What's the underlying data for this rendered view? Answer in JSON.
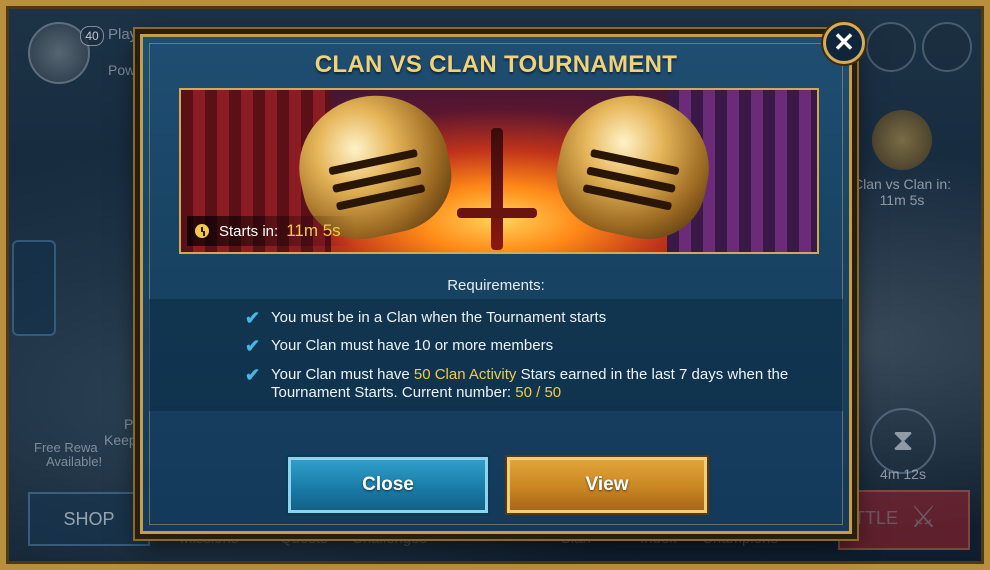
{
  "background": {
    "player_name": "Play",
    "player_level": "40",
    "power_label": "Power",
    "free_rewards": "Free Rewa",
    "available": "Available!",
    "side_text_1": "Pro",
    "side_text_2": "Keep p",
    "shop_label": "SHOP",
    "battle_label": "TTLE",
    "clan_event_title": "Clan vs Clan in:",
    "clan_event_time": "11m 5s",
    "hourglass_time": "4m 12s",
    "bottom_tabs": [
      "Missions",
      "Quests",
      "Challenges",
      "Clan",
      "Index",
      "Champions"
    ],
    "icons": {
      "hourglass": "hourglass-icon",
      "swords": "crossed-swords-icon",
      "chest": "chest-icon",
      "chat": "chat-icon"
    }
  },
  "modal": {
    "title": "CLAN VS CLAN TOURNAMENT",
    "banner": {
      "starts_label": "Starts in:",
      "starts_value": "11m 5s"
    },
    "requirements_header": "Requirements:",
    "requirements": {
      "r1": "You must be in a Clan when the Tournament starts",
      "r2": "Your Clan must have 10 or more members",
      "r3_a": "Your Clan must have ",
      "r3_highlight": "50 Clan Activity",
      "r3_b": " Stars earned in the last 7 days when the Tournament Starts. Current number: ",
      "r3_value": "50 / 50"
    },
    "buttons": {
      "close": "Close",
      "view": "View"
    },
    "close_glyph": "✕"
  },
  "colors": {
    "gold": "#f2c94c",
    "title": "#f0d27a",
    "check": "#49b5e5",
    "close_button": "#1a7ca8",
    "view_button": "#c98622"
  }
}
